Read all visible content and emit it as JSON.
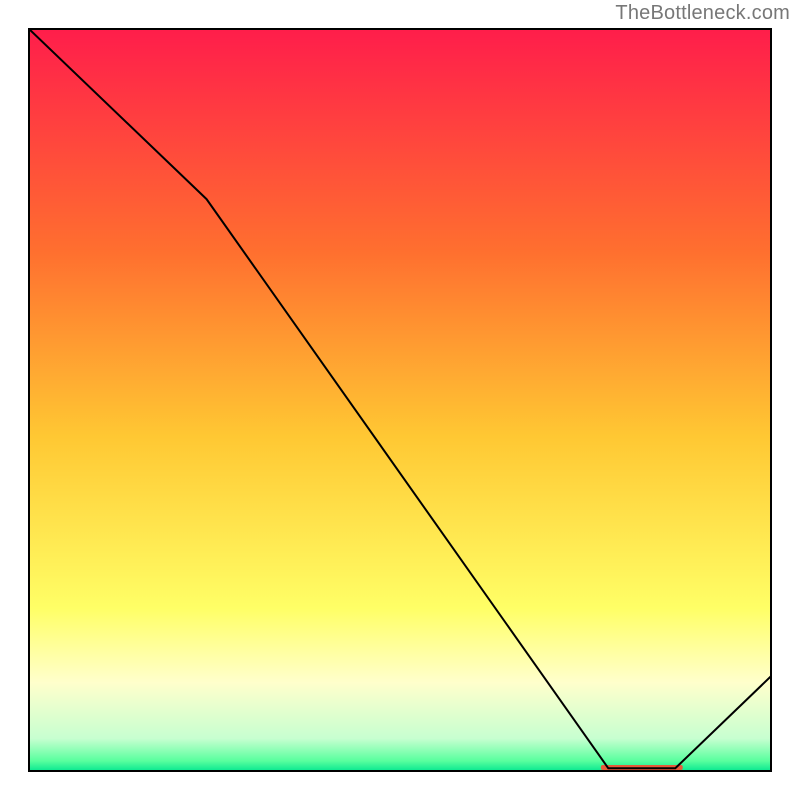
{
  "attribution": "TheBottleneck.com",
  "chart_data": {
    "type": "line",
    "title": "",
    "xlabel": "",
    "ylabel": "",
    "xlim": [
      0,
      100
    ],
    "ylim": [
      0,
      100
    ],
    "grid": false,
    "legend": false,
    "background": {
      "type": "vertical-gradient",
      "stops": [
        {
          "offset": 0.0,
          "color": "#ff1d4b"
        },
        {
          "offset": 0.3,
          "color": "#ff6f2f"
        },
        {
          "offset": 0.55,
          "color": "#ffc833"
        },
        {
          "offset": 0.78,
          "color": "#ffff66"
        },
        {
          "offset": 0.88,
          "color": "#ffffcc"
        },
        {
          "offset": 0.955,
          "color": "#c7ffd0"
        },
        {
          "offset": 0.985,
          "color": "#59ff9e"
        },
        {
          "offset": 1.0,
          "color": "#00e58f"
        }
      ]
    },
    "line": {
      "color": "#000000",
      "width": 2,
      "points": [
        {
          "x": 0,
          "y": 100.0
        },
        {
          "x": 24,
          "y": 77.0
        },
        {
          "x": 78,
          "y": 0.5
        },
        {
          "x": 87,
          "y": 0.5
        },
        {
          "x": 100,
          "y": 13.0
        }
      ]
    },
    "highlight_band": {
      "x_start": 77,
      "x_end": 88,
      "y": 0.6,
      "color": "#e65a3a"
    },
    "axes": {
      "x_ticks": [],
      "y_ticks": []
    }
  }
}
